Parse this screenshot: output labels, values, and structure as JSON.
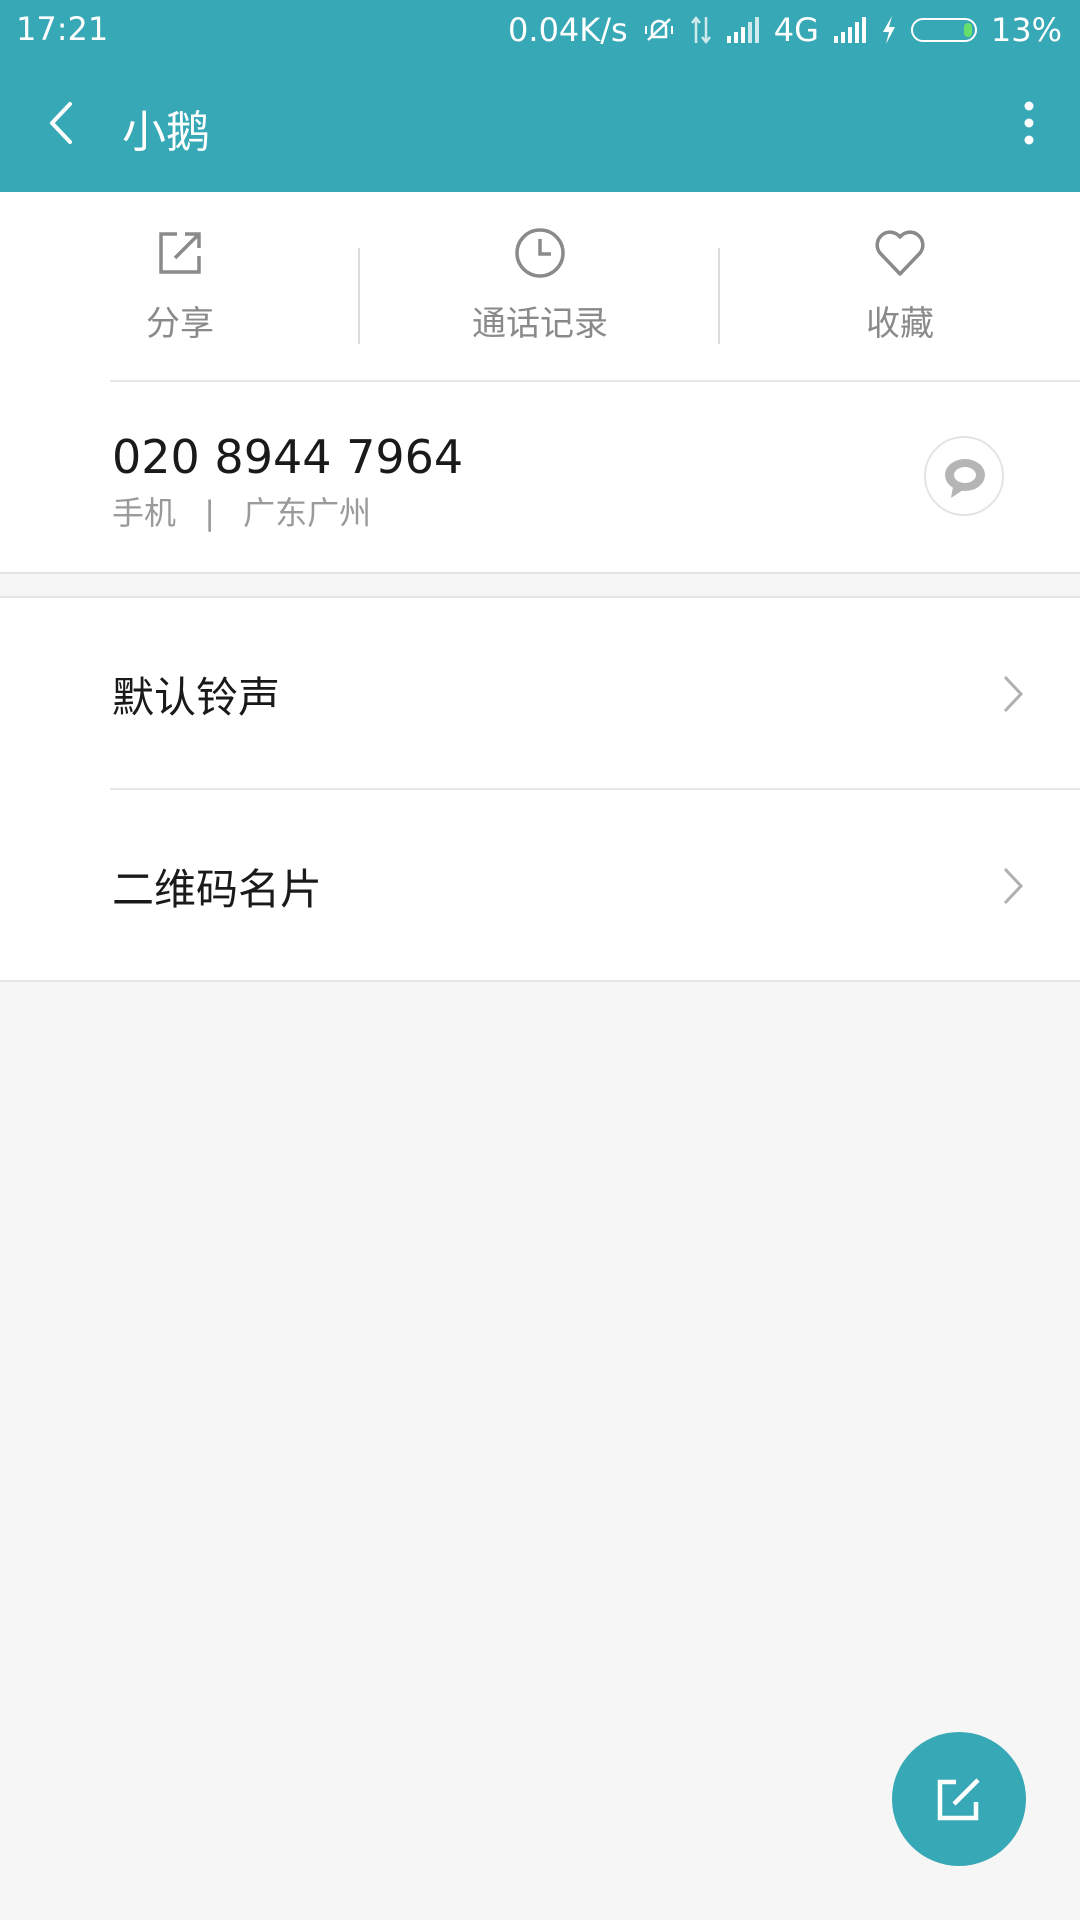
{
  "status_bar": {
    "time": "17:21",
    "net_speed": "0.04K/s",
    "network_type": "4G",
    "battery": "13%",
    "icons": [
      "mute-icon",
      "data-arrows-icon",
      "signal-icon",
      "signal-icon",
      "charging-icon",
      "battery-icon"
    ]
  },
  "appbar": {
    "title": "小鹅",
    "back_icon": "back-arrow-icon",
    "menu_icon": "more-vertical-icon"
  },
  "actions": [
    {
      "label": "分享",
      "icon": "share-icon"
    },
    {
      "label": "通话记录",
      "icon": "clock-icon"
    },
    {
      "label": "收藏",
      "icon": "heart-icon"
    }
  ],
  "phone": {
    "number": "020 8944 7964",
    "type": "手机",
    "separator": "|",
    "location": "广东广州",
    "message_icon": "message-icon"
  },
  "settings": [
    {
      "label": "默认铃声",
      "icon": "chevron-right-icon"
    },
    {
      "label": "二维码名片",
      "icon": "chevron-right-icon"
    }
  ],
  "fab": {
    "icon": "edit-icon"
  },
  "colors": {
    "accent": "#37a8b5",
    "background": "#f6f6f6",
    "surface": "#ffffff",
    "secondary_text": "#8a8a8a",
    "battery_fill": "#66e06a"
  }
}
